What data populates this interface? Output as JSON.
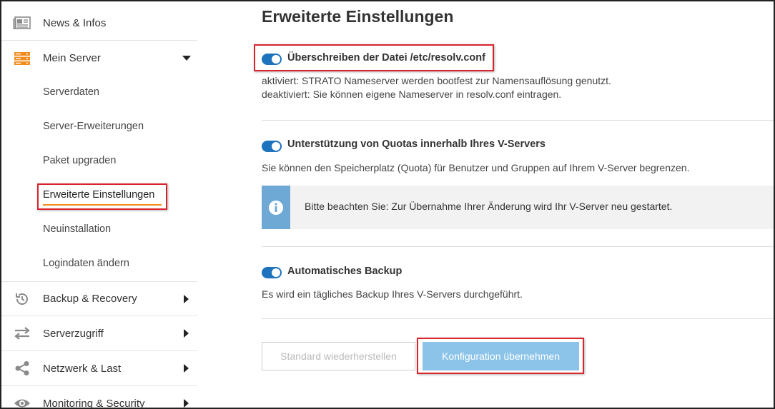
{
  "sidebar": {
    "items": [
      {
        "label": "News & Infos",
        "icon": "newspaper-icon"
      },
      {
        "label": "Mein Server",
        "icon": "server-icon"
      },
      {
        "label": "Backup & Recovery",
        "icon": "history-icon"
      },
      {
        "label": "Serverzugriff",
        "icon": "transfer-arrows-icon"
      },
      {
        "label": "Netzwerk & Last",
        "icon": "share-network-icon"
      },
      {
        "label": "Monitoring & Security",
        "icon": "eye-icon"
      }
    ],
    "sub_items": [
      {
        "label": "Serverdaten"
      },
      {
        "label": "Server-Erweiterungen"
      },
      {
        "label": "Paket upgraden"
      },
      {
        "label": "Erweiterte Einstellungen",
        "active": true
      },
      {
        "label": "Neuinstallation"
      },
      {
        "label": "Logindaten ändern"
      }
    ]
  },
  "main": {
    "title": "Erweiterte Einstellungen",
    "settings": [
      {
        "title": "Überschreiben der Datei /etc/resolv.conf",
        "enabled": true,
        "desc_lines": [
          "aktiviert: STRATO Nameserver werden bootfest zur Namensauflösung genutzt.",
          "deaktiviert: Sie können eigene Nameserver in resolv.conf eintragen."
        ]
      },
      {
        "title": "Unterstützung von Quotas innerhalb Ihres V-Servers",
        "enabled": true,
        "desc_lines": [
          "Sie können den Speicherplatz (Quota) für Benutzer und Gruppen auf Ihrem V-Server begrenzen."
        ],
        "info": "Bitte beachten Sie: Zur Übernahme Ihrer Änderung wird Ihr V-Server neu gestartet."
      },
      {
        "title": "Automatisches Backup",
        "enabled": true,
        "desc_lines": [
          "Es wird ein tägliches Backup Ihres V-Servers durchgeführt."
        ]
      }
    ],
    "buttons": {
      "reset": "Standard wiederherstellen",
      "apply": "Konfiguration übernehmen"
    }
  },
  "colors": {
    "toggle_on": "#1e73be",
    "highlight_border": "#d9232d",
    "active_underline": "#f28c1c",
    "info_side": "#6ea9d6",
    "apply_button": "#8bc4e8",
    "server_icon": "#f28c1c"
  }
}
